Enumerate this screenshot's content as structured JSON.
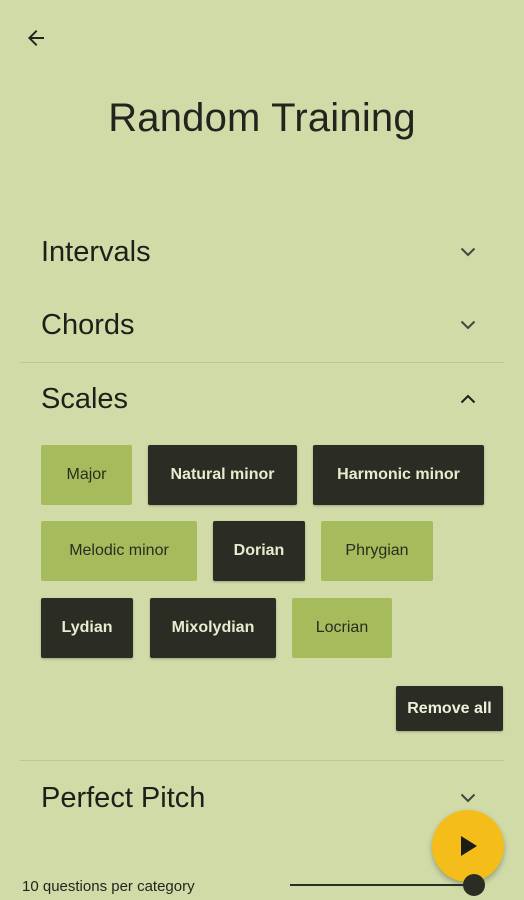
{
  "header": {
    "title": "Random Training"
  },
  "sections": [
    {
      "label": "Intervals",
      "expanded": false
    },
    {
      "label": "Chords",
      "expanded": false
    },
    {
      "label": "Scales",
      "expanded": true
    },
    {
      "label": "Perfect Pitch",
      "expanded": false
    }
  ],
  "scales": {
    "chips": [
      {
        "label": "Major",
        "selected": false
      },
      {
        "label": "Natural minor",
        "selected": true
      },
      {
        "label": "Harmonic minor",
        "selected": true
      },
      {
        "label": "Melodic minor",
        "selected": false
      },
      {
        "label": "Dorian",
        "selected": true
      },
      {
        "label": "Phrygian",
        "selected": false
      },
      {
        "label": "Lydian",
        "selected": true
      },
      {
        "label": "Mixolydian",
        "selected": true
      },
      {
        "label": "Locrian",
        "selected": false
      }
    ],
    "remove_all_label": "Remove all"
  },
  "footer": {
    "questions_label": "10 questions per category",
    "slider_value_fraction": 1.0
  },
  "colors": {
    "background": "#d1dba8",
    "chip_selected": "#2b2d24",
    "chip_unselected": "#a6bc5c",
    "fab": "#f5bd1a"
  },
  "icons": {
    "back": "arrow-left-icon",
    "collapsed": "chevron-down-icon",
    "expanded": "chevron-up-icon",
    "fab": "play-icon"
  }
}
